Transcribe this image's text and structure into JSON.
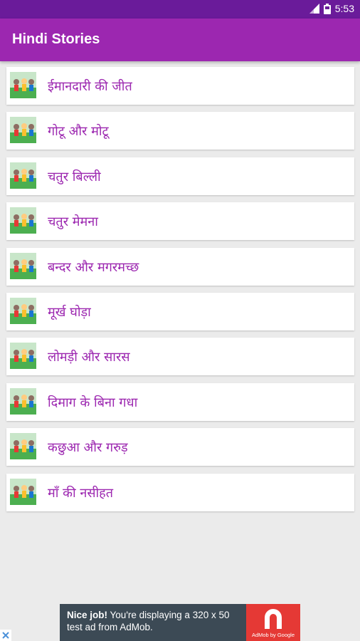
{
  "status_bar": {
    "time": "5:53",
    "icons": [
      "signal-icon",
      "battery-icon"
    ]
  },
  "app_bar": {
    "title": "Hindi Stories",
    "color": "#9c27b0",
    "status_color": "#6a1b9a"
  },
  "stories": [
    {
      "title": "ईमानदारी की जीत"
    },
    {
      "title": "गोटू और मोटू"
    },
    {
      "title": "चतुर बिल्ली"
    },
    {
      "title": "चतुर मेमना"
    },
    {
      "title": "बन्दर और मगरमच्छ"
    },
    {
      "title": "मूर्ख घोड़ा"
    },
    {
      "title": "लोमड़ी और सारस"
    },
    {
      "title": "दिमाग के बिना गधा"
    },
    {
      "title": "कछुआ और गरुड़"
    },
    {
      "title": "माँ की नसीहत"
    }
  ],
  "ad": {
    "headline": "Nice job!",
    "body": "You're displaying a 320 x 50 test ad from AdMob.",
    "logo_caption": "AdMob by Google",
    "accent": "#e53935",
    "background": "#3c4a55"
  }
}
